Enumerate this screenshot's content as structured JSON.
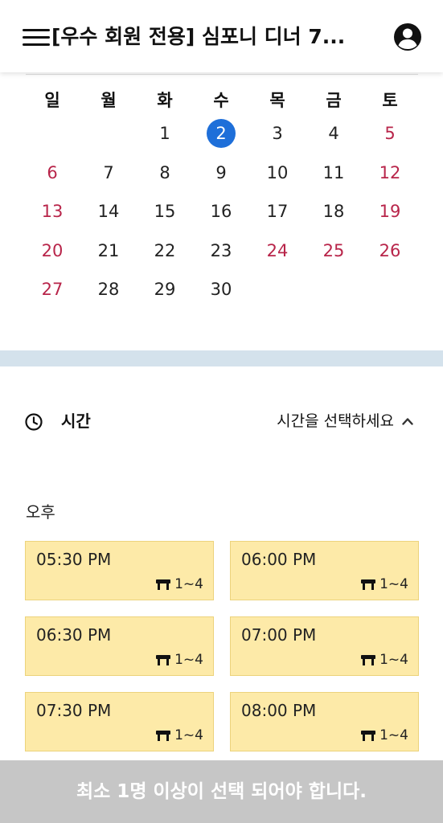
{
  "header": {
    "title": "[우수 회원 전용] 심포니 디너 7...",
    "menu_icon": "hamburger-menu-icon",
    "profile_icon": "account-circle-icon"
  },
  "calendar": {
    "weekdays": [
      "일",
      "월",
      "화",
      "수",
      "목",
      "금",
      "토"
    ],
    "selected_day": "2",
    "weeks": [
      [
        "",
        "",
        "1",
        "2",
        "3",
        "4",
        "5"
      ],
      [
        "6",
        "7",
        "8",
        "9",
        "10",
        "11",
        "12"
      ],
      [
        "13",
        "14",
        "15",
        "16",
        "17",
        "18",
        "19"
      ],
      [
        "20",
        "21",
        "22",
        "23",
        "24",
        "25",
        "26"
      ],
      [
        "27",
        "28",
        "29",
        "30",
        "",
        "",
        ""
      ]
    ],
    "highlight_color": "#b8254a",
    "selected_color": "#1e6fd9"
  },
  "time_selector": {
    "label": "시간",
    "placeholder": "시간을 선택하세요",
    "icon": "clock-icon"
  },
  "period": "오후",
  "slots": [
    {
      "time": "05:30 PM",
      "capacity": "1~4"
    },
    {
      "time": "06:00 PM",
      "capacity": "1~4"
    },
    {
      "time": "06:30 PM",
      "capacity": "1~4"
    },
    {
      "time": "07:00 PM",
      "capacity": "1~4"
    },
    {
      "time": "07:30 PM",
      "capacity": "1~4"
    },
    {
      "time": "08:00 PM",
      "capacity": "1~4"
    }
  ],
  "bottom_bar": {
    "text": "최소 1명 이상이 선택 되어야 합니다."
  },
  "colors": {
    "slot_bg": "#fdeaa8",
    "band": "#d4e2ec",
    "bottom_bar": "#c6c6c6"
  }
}
